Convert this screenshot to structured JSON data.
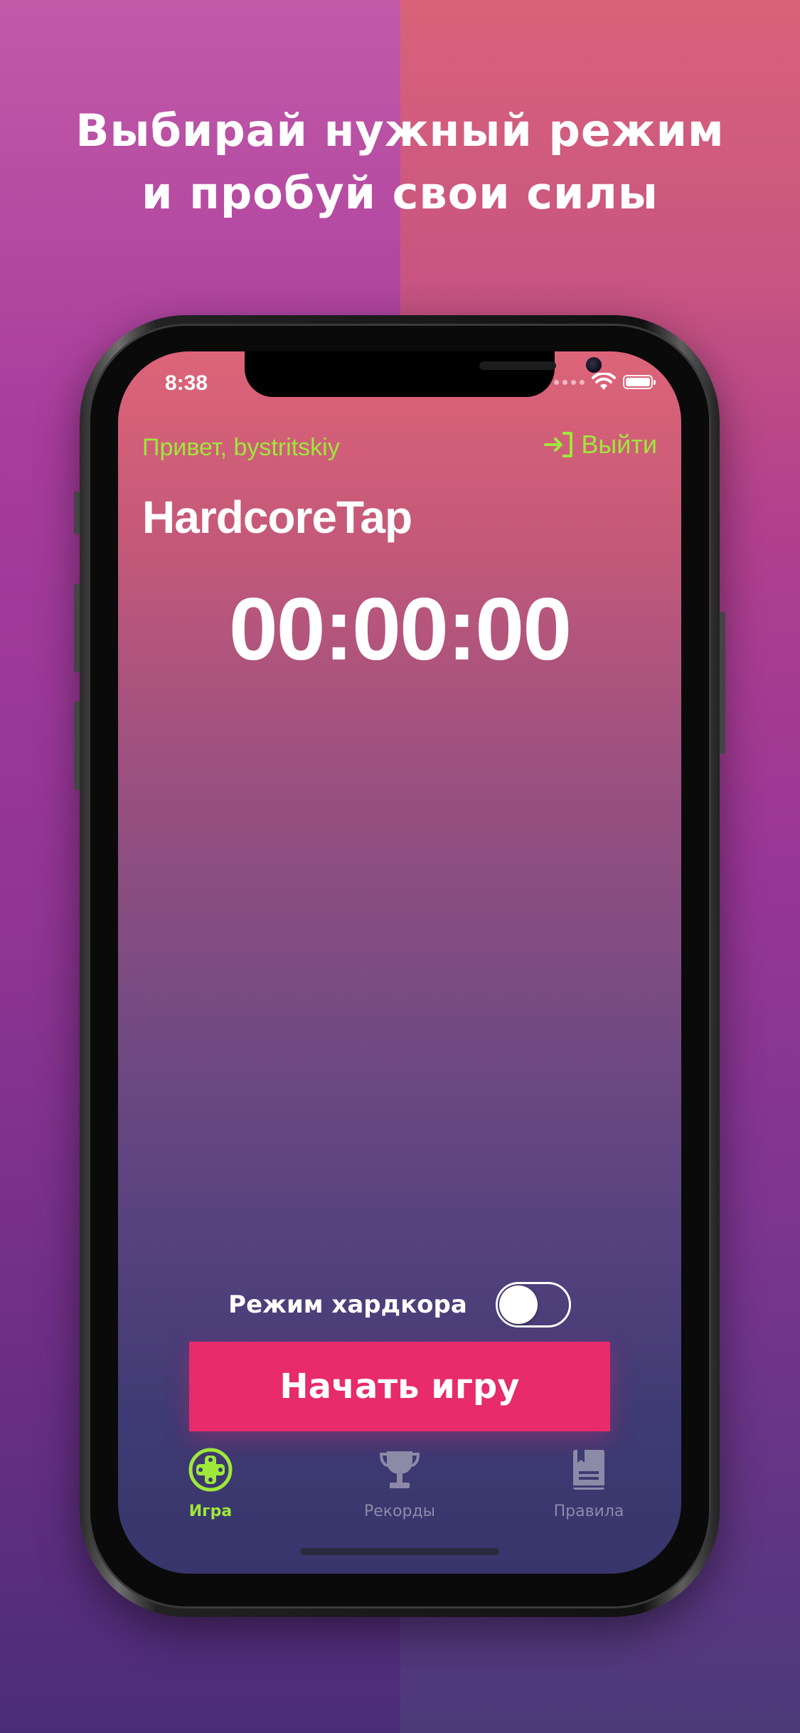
{
  "headline": {
    "line1": "Выбирай нужный режим",
    "line2": "и пробуй свои силы"
  },
  "status_bar": {
    "time": "8:38"
  },
  "header": {
    "greeting": "Привет, bystritskiy",
    "logout_label": "Выйти"
  },
  "app": {
    "title": "HardcoreTap",
    "timer": "00:00:00"
  },
  "hardcore_mode": {
    "label": "Режим хардкора",
    "enabled": false
  },
  "start_button": {
    "label": "Начать игру"
  },
  "tabbar": {
    "tabs": [
      {
        "label": "Игра",
        "icon": "gamepad-icon",
        "active": true
      },
      {
        "label": "Рекорды",
        "icon": "trophy-icon",
        "active": false
      },
      {
        "label": "Правила",
        "icon": "book-icon",
        "active": false
      }
    ]
  },
  "colors": {
    "accent_green": "#9ee83a",
    "button_pink": "#e72b6b",
    "tab_inactive": "#8d8aa8"
  }
}
